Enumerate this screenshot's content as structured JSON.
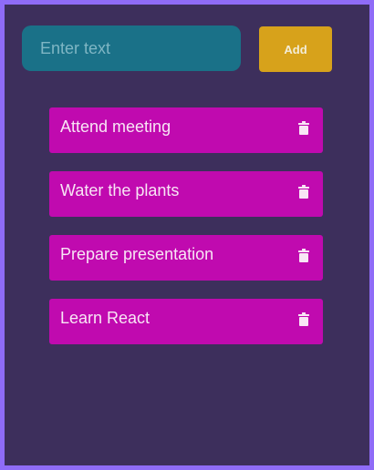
{
  "input": {
    "placeholder": "Enter text",
    "value": ""
  },
  "add_button": {
    "label": "Add"
  },
  "todos": [
    {
      "text": "Attend meeting",
      "icon": "trash-icon"
    },
    {
      "text": "Water the plants",
      "icon": "trash-icon"
    },
    {
      "text": "Prepare presentation",
      "icon": "trash-icon"
    },
    {
      "text": "Learn React",
      "icon": "trash-icon"
    }
  ],
  "colors": {
    "frame_border": "#8f6cf7",
    "background": "#3d2f5c",
    "input_background": "#1a7188",
    "add_button": "#d7a21b",
    "todo_item": "#c00aaf",
    "todo_text": "#f8e6f5"
  }
}
